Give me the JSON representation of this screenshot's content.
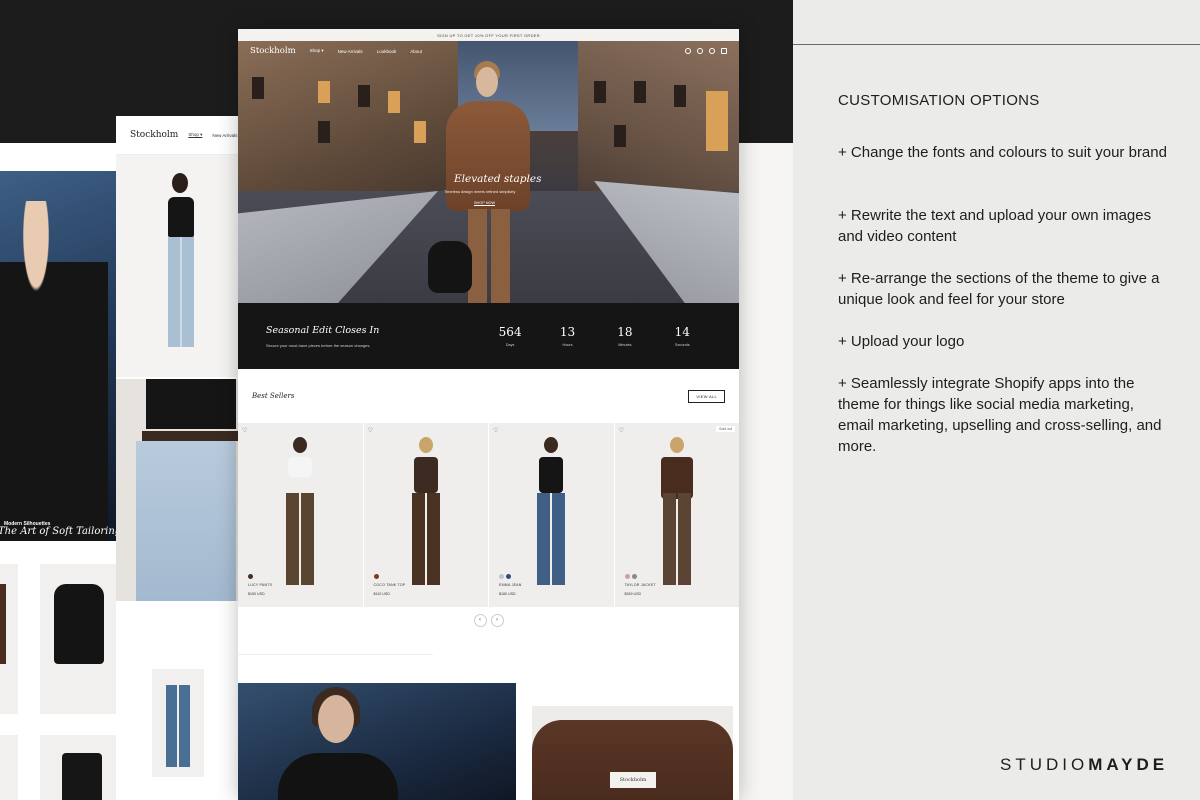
{
  "mockup": {
    "announcement": "SIGN UP TO GET 10% OFF YOUR FIRST ORDER",
    "logo": "Stockholm",
    "nav": [
      "Shop ▾",
      "New Arrivals",
      "Lookbook",
      "About"
    ],
    "hero": {
      "headline": "Elevated staples",
      "subtext": "Timeless design meets refined simplicity",
      "cta": "SHOP NOW"
    },
    "countdown": {
      "title": "Seasonal Edit Closes In",
      "subtitle": "Secure your must-have pieces before the season changes.",
      "units": [
        {
          "value": "564",
          "label": "Days"
        },
        {
          "value": "13",
          "label": "Hours"
        },
        {
          "value": "18",
          "label": "Minutes"
        },
        {
          "value": "14",
          "label": "Seconds"
        }
      ]
    },
    "best_sellers": {
      "title": "Best Sellers",
      "view_all": "VIEW ALL",
      "products": [
        {
          "name": "LUCY PANTS",
          "price": "$150 USD",
          "badge": ""
        },
        {
          "name": "COCO TANK TOP",
          "price": "$110 USD",
          "badge": ""
        },
        {
          "name": "EMMA JEAN",
          "price": "$180 USD",
          "badge": ""
        },
        {
          "name": "TAYLOR JACKET",
          "price": "$349 USD",
          "badge": "Sold out"
        }
      ],
      "pager_prev": "‹",
      "pager_next": "›"
    },
    "mid_nav": [
      "Shop ▾",
      "New Arrivals"
    ],
    "back_hero": {
      "tag": "Modern Silhouettes",
      "title": "The Art of Soft Tailoring"
    },
    "shirt_label": "Stockholm"
  },
  "panel": {
    "heading": "CUSTOMISATION OPTIONS",
    "bullets": [
      "+ Change the fonts and colours to suit your brand",
      "+ Rewrite the text and upload your own images and video content",
      "+ Re-arrange the sections of the theme to give a unique look and feel for your store",
      "+ Upload your logo",
      "+ Seamlessly integrate Shopify apps into the theme for things like social media marketing, email marketing, upselling and cross-selling, and more."
    ],
    "brand_light": "STUDIO",
    "brand_bold": "MAYDE"
  }
}
